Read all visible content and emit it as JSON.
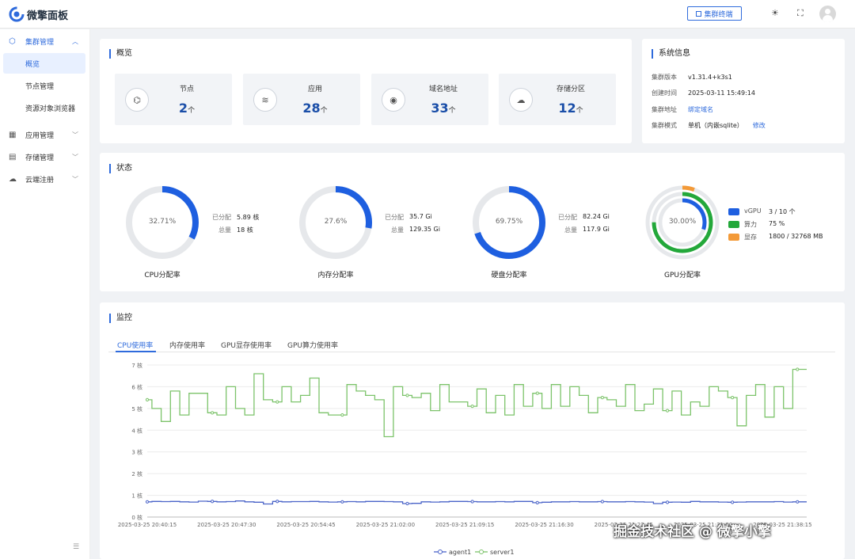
{
  "app": {
    "title": "微擎面板"
  },
  "topbar": {
    "terminal_label": "集群终端",
    "theme_icon": "sun-icon",
    "fullscreen_icon": "fullscreen-icon",
    "avatar_icon": "user-avatar-icon"
  },
  "sidebar": {
    "cluster": {
      "label": "集群管理",
      "icon": "cube-icon"
    },
    "overview": {
      "label": "概览"
    },
    "nodes": {
      "label": "节点管理"
    },
    "browser": {
      "label": "资源对象浏览器"
    },
    "apps": {
      "label": "应用管理",
      "icon": "grid-icon"
    },
    "storage": {
      "label": "存储管理",
      "icon": "storage-icon"
    },
    "cloud": {
      "label": "云端注册",
      "icon": "cloud-icon"
    }
  },
  "overview": {
    "title": "概览",
    "stats": [
      {
        "label": "节点",
        "value": "2",
        "unit": "个",
        "icon": "nodes-icon"
      },
      {
        "label": "应用",
        "value": "28",
        "unit": "个",
        "icon": "layers-icon"
      },
      {
        "label": "域名地址",
        "value": "33",
        "unit": "个",
        "icon": "www-icon"
      },
      {
        "label": "存储分区",
        "value": "12",
        "unit": "个",
        "icon": "cloud-disk-icon"
      }
    ]
  },
  "sysinfo": {
    "title": "系统信息",
    "version_key": "集群版本",
    "version": "v1.31.4+k3s1",
    "created_key": "创建时间",
    "created": "2025-03-11 15:49:14",
    "address_key": "集群地址",
    "address_link": "绑定域名",
    "mode_key": "集群模式",
    "mode": "单机（内嵌sqlite）",
    "mode_edit": "修改"
  },
  "status": {
    "title": "状态",
    "cpu": {
      "pct": "32.71%",
      "ratio": 0.3271,
      "label": "CPU分配率",
      "k1": "已分配",
      "v1": "5.89 核",
      "k2": "总量",
      "v2": "18 核"
    },
    "mem": {
      "pct": "27.6%",
      "ratio": 0.276,
      "label": "内存分配率",
      "k1": "已分配",
      "v1": "35.7 Gi",
      "k2": "总量",
      "v2": "129.35 Gi"
    },
    "disk": {
      "pct": "69.75%",
      "ratio": 0.6975,
      "label": "硬盘分配率",
      "k1": "已分配",
      "v1": "82.24 Gi",
      "k2": "总量",
      "v2": "117.9 Gi"
    },
    "gpu": {
      "pct": "30.00%",
      "label": "GPU分配率",
      "legend": [
        {
          "key": "vGPU",
          "value": "3 / 10 个",
          "color": "#1e5fe0",
          "ratio": 0.3
        },
        {
          "key": "算力",
          "value": "75 %",
          "color": "#23a83a",
          "ratio": 0.75
        },
        {
          "key": "显存",
          "value": "1800 / 32768 MB",
          "color": "#f39a38",
          "ratio": 0.055
        }
      ]
    }
  },
  "monitor": {
    "title": "监控",
    "tabs": [
      "CPU使用率",
      "内存使用率",
      "GPU显存使用率",
      "GPU算力使用率"
    ]
  },
  "chart_data": {
    "type": "line",
    "ylim": [
      0,
      7
    ],
    "yticks": [
      "0 核",
      "1 核",
      "2 核",
      "3 核",
      "4 核",
      "5 核",
      "6 核",
      "7 核"
    ],
    "xticks": [
      "2025-03-25 20:40:15",
      "2025-03-25 20:47:30",
      "2025-03-25 20:54:45",
      "2025-03-25 21:02:00",
      "2025-03-25 21:09:15",
      "2025-03-25 21:16:30",
      "2025-03-25 21:23:45",
      "2025-03-25 21:31:00",
      "2025-03-25 21:38:15"
    ],
    "series": [
      {
        "name": "agent1",
        "color": "#4a63c8",
        "values": [
          0.7,
          0.72,
          0.71,
          0.72,
          0.7,
          0.69,
          0.73,
          0.72,
          0.7,
          0.71,
          0.74,
          0.7,
          0.68,
          0.6,
          0.72,
          0.7,
          0.71,
          0.71,
          0.72,
          0.7,
          0.69,
          0.7,
          0.71,
          0.7,
          0.72,
          0.72,
          0.71,
          0.7,
          0.62,
          0.63,
          0.7,
          0.69,
          0.7,
          0.72,
          0.72,
          0.71,
          0.7,
          0.7,
          0.71,
          0.7,
          0.72,
          0.72,
          0.66,
          0.68,
          0.7,
          0.7,
          0.71,
          0.7,
          0.7,
          0.71,
          0.7,
          0.7,
          0.71,
          0.7,
          0.69,
          0.62,
          0.68,
          0.69,
          0.68,
          0.72,
          0.7,
          0.7,
          0.69,
          0.68,
          0.69,
          0.7,
          0.7,
          0.7,
          0.71,
          0.69,
          0.7,
          0.7
        ]
      },
      {
        "name": "server1",
        "color": "#7cc36a",
        "values": [
          5.4,
          5.0,
          4.4,
          5.8,
          4.7,
          5.7,
          5.7,
          4.8,
          4.7,
          6.0,
          5.0,
          4.7,
          6.6,
          5.4,
          5.3,
          6.0,
          5.3,
          5.6,
          6.4,
          4.8,
          4.7,
          4.7,
          6.1,
          5.8,
          5.6,
          5.4,
          3.7,
          6.0,
          5.6,
          5.5,
          5.7,
          4.9,
          6.1,
          5.3,
          5.3,
          5.1,
          5.9,
          4.8,
          5.6,
          4.7,
          6.1,
          5.1,
          5.7,
          5.0,
          6.1,
          5.1,
          6.0,
          5.6,
          4.8,
          5.5,
          5.4,
          5.1,
          6.1,
          4.9,
          5.2,
          5.9,
          4.9,
          5.8,
          4.7,
          5.3,
          5.1,
          6.0,
          5.8,
          5.5,
          4.2,
          5.6,
          6.1,
          4.6,
          6.0,
          5.0,
          6.8,
          6.8
        ]
      }
    ]
  },
  "watermark": "掘金技术社区 @ 微擎小擎"
}
